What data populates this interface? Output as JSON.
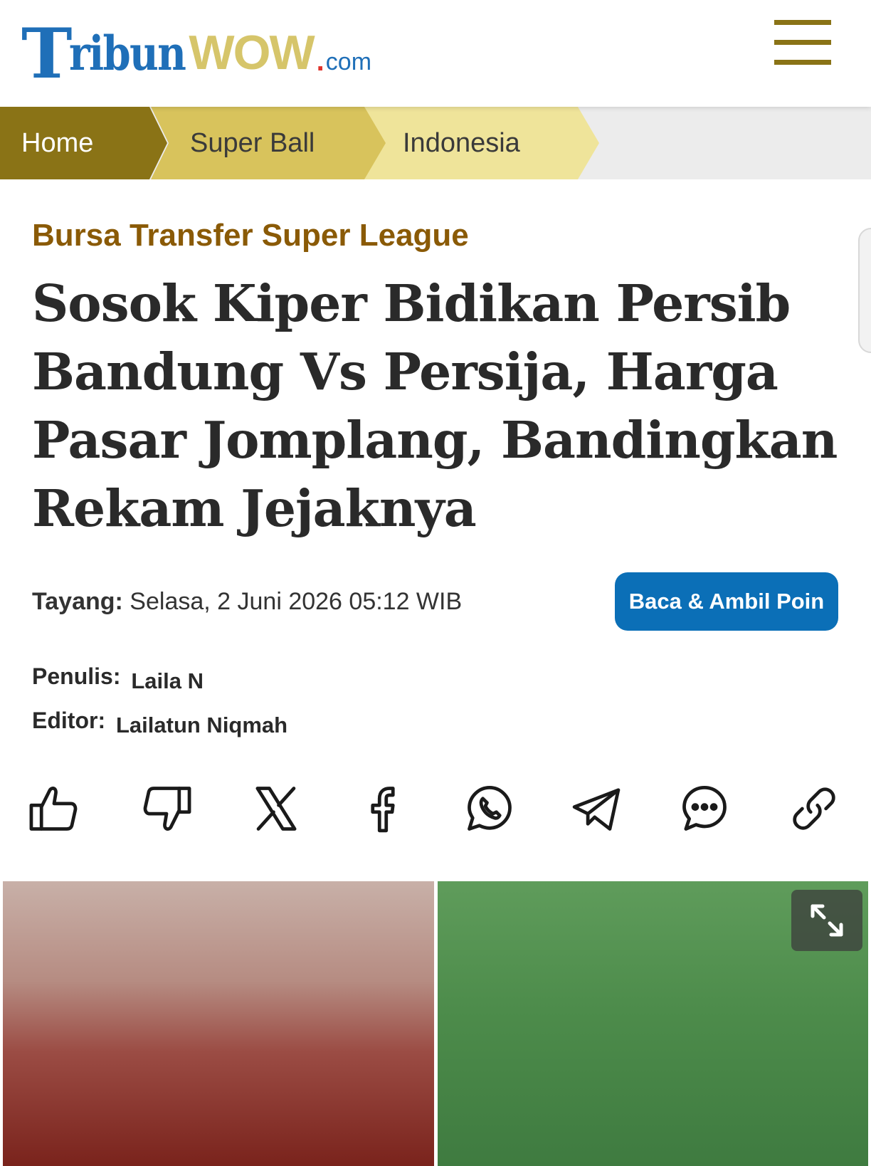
{
  "header": {
    "logo": {
      "part1": "T",
      "part2": "ribun",
      "part3": "WOW",
      "dot": ".",
      "part4": "com"
    },
    "menu_icon": "hamburger-icon"
  },
  "breadcrumb": [
    "Home",
    "Super Ball",
    "Indonesia"
  ],
  "article": {
    "kanal": "Bursa Transfer Super League",
    "title": "Sosok Kiper Bidikan Persib Bandung Vs Persija, Harga Pasar Jomplang, Bandingkan Rekam Jejaknya",
    "date_label": "Tayang:",
    "date_value": "Selasa, 2 Juni 2026 05:12 WIB",
    "poin_button": "Baca & Ambil Poin",
    "penulis_label": "Penulis:",
    "penulis_value": "Laila N",
    "editor_label": "Editor:",
    "editor_value": "Lailatun Niqmah"
  },
  "share_icons": [
    "thumbs-up-icon",
    "thumbs-down-icon",
    "x-icon",
    "facebook-icon",
    "whatsapp-icon",
    "telegram-icon",
    "comment-icon",
    "link-icon"
  ],
  "colors": {
    "brand_blue": "#1f6fb8",
    "brand_gold": "#8a7316",
    "kanal": "#8a5a06",
    "button_blue": "#0b6fb7"
  }
}
